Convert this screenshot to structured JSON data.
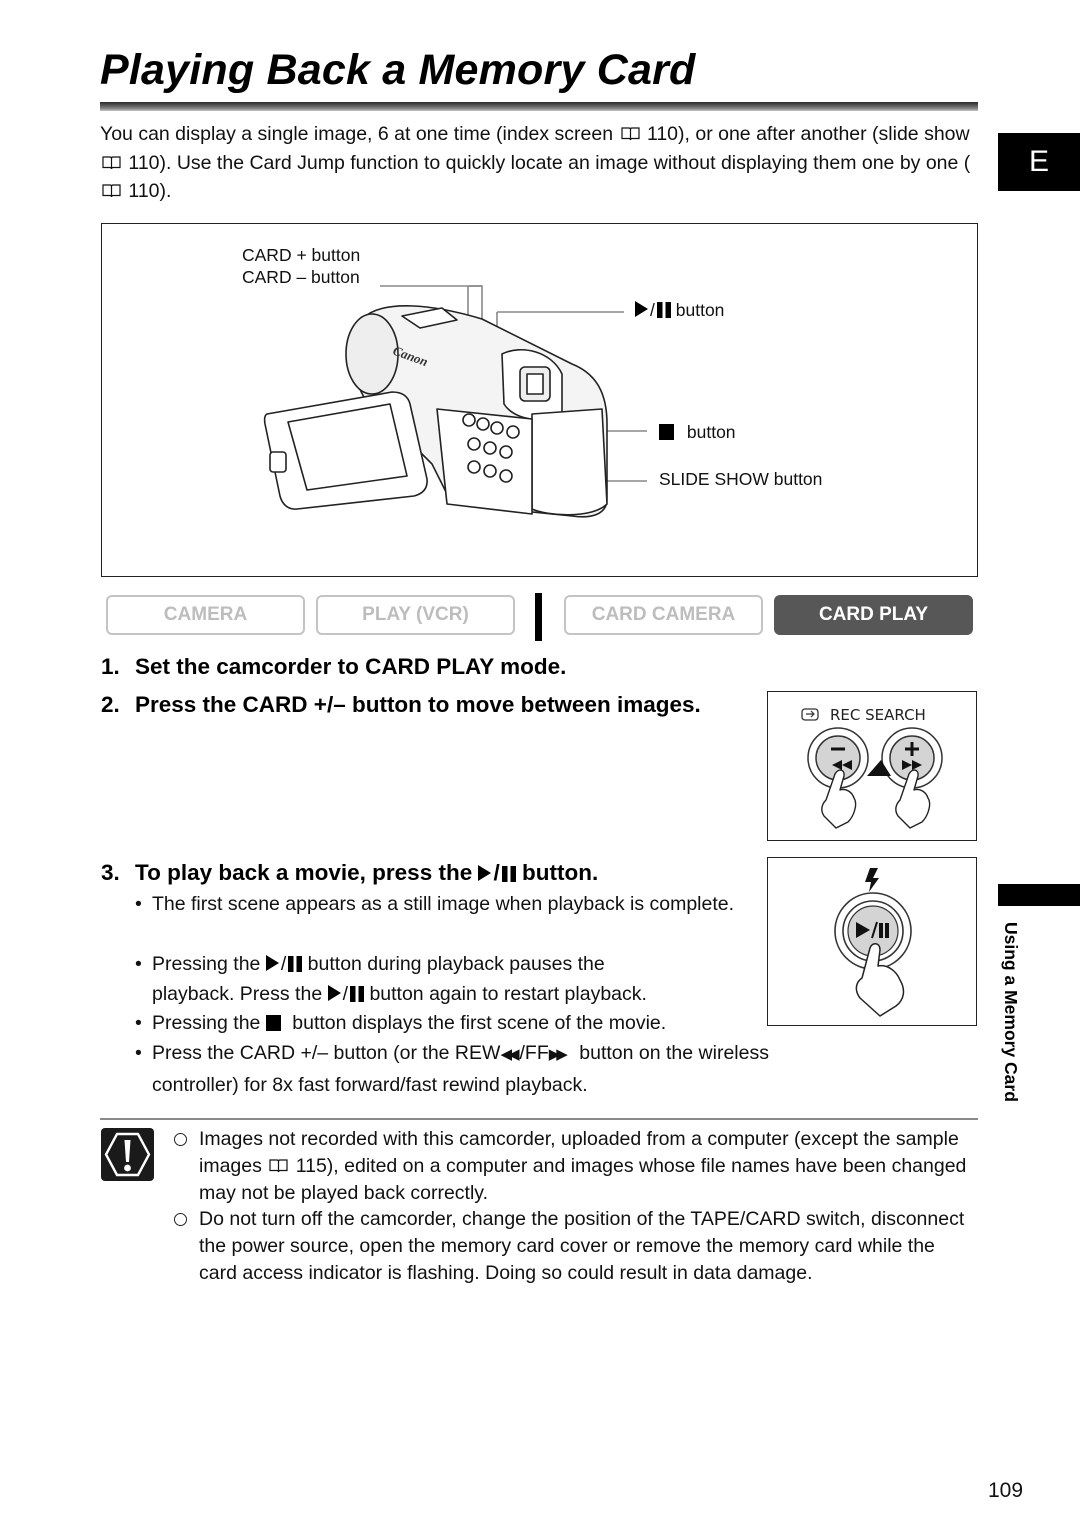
{
  "page": {
    "title": "Playing Back a Memory Card",
    "language_tab": "E",
    "side_label": "Using a Memory Card",
    "page_number": "109"
  },
  "intro": {
    "part1": "You can display a single image, 6 at one time (index screen",
    "ref1": "110), or one after another (slide show",
    "ref2": "110). Use the Card Jump function to quickly locate an image without displaying them one by one (",
    "ref3": "110)."
  },
  "figure": {
    "labels": {
      "card_plus": "CARD + button",
      "card_minus": "CARD – button",
      "play_pause": "button",
      "stop": "button",
      "slide_show": "SLIDE SHOW button"
    },
    "brand_text": "Canon"
  },
  "modes": {
    "items": [
      {
        "label": "CAMERA",
        "active": false
      },
      {
        "label": "PLAY (VCR)",
        "active": false
      },
      {
        "label": "CARD CAMERA",
        "active": false
      },
      {
        "label": "CARD PLAY",
        "active": true
      }
    ],
    "active_color": "#575757",
    "inactive_color": "#c4c4c4"
  },
  "steps": [
    {
      "num": "1.",
      "text": "Set the camcorder to CARD PLAY mode."
    },
    {
      "num": "2.",
      "text": "Press the CARD +/– button to move between images."
    },
    {
      "num": "3.",
      "text_before": "To play back a movie, press the",
      "text_after": "button."
    }
  ],
  "step3_bullets": {
    "b1": "The first scene appears as a still image when playback is complete.",
    "b2_a": "Pressing the",
    "b2_b": "button during playback pauses the",
    "b2_c": "playback. Press the",
    "b2_d": "button again to restart playback.",
    "b3_a": "Pressing the",
    "b3_b": "button displays the first scene of the movie.",
    "b4_a": "Press the CARD +/– button (or the REW",
    "b4_b": "/FF",
    "b4_c": "button on the wireless",
    "b4_d": "controller) for 8x fast forward/fast rewind playback."
  },
  "illustrations": {
    "rec_search_label": "REC SEARCH"
  },
  "cautions": [
    {
      "before": "Images not recorded with this camcorder, uploaded from a computer (except the sample images",
      "after": "115), edited on a computer and images whose file names have been changed may not be played back correctly."
    },
    {
      "text": "Do not turn off the camcorder, change the position of the TAPE/CARD switch, disconnect the power source, open the memory card cover or remove the memory card while the card access indicator is flashing. Doing so could result in data damage."
    }
  ]
}
